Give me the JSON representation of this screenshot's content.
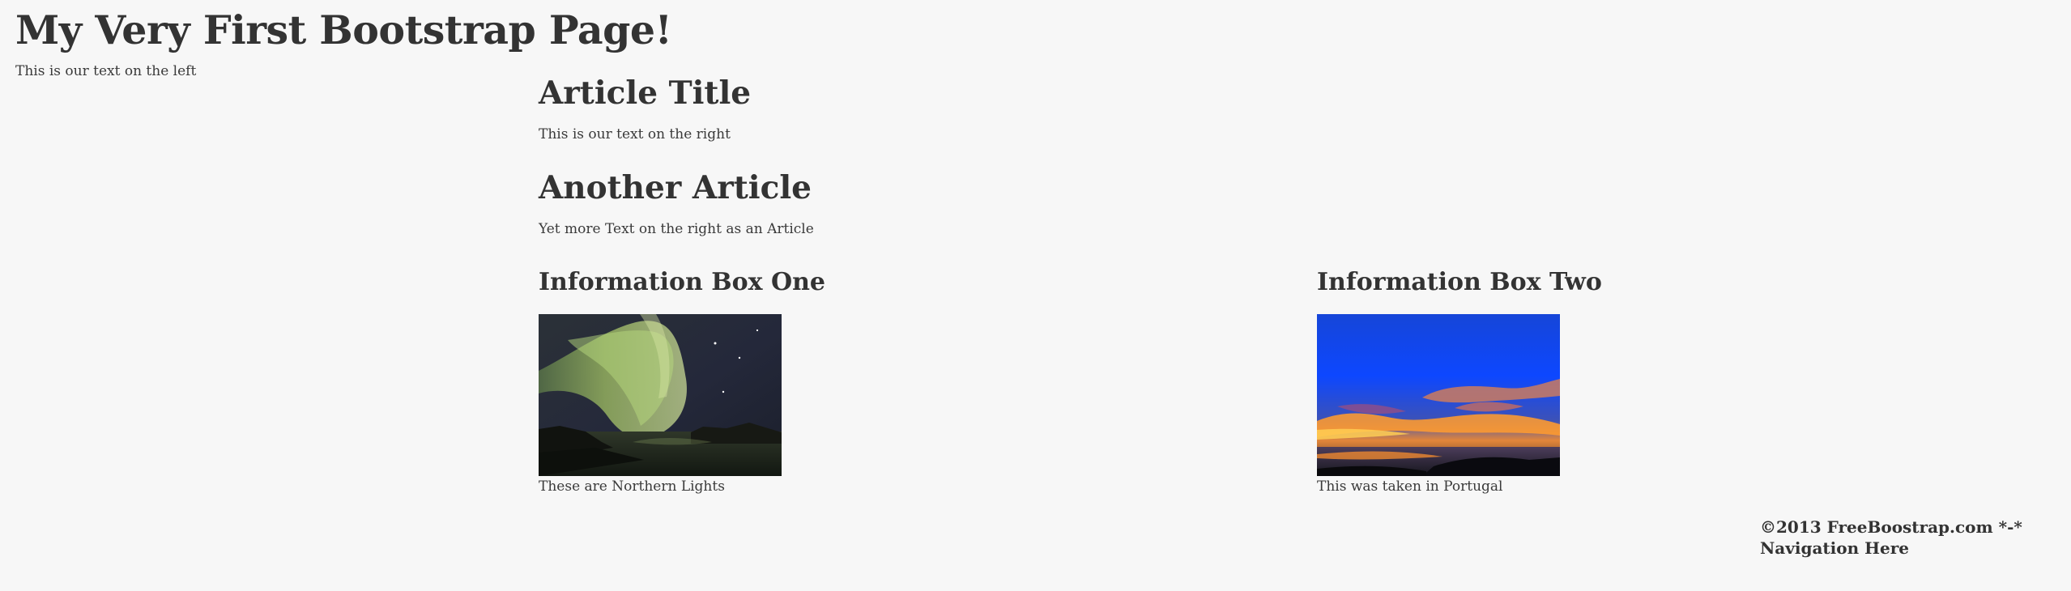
{
  "header": {
    "title": "My Very First Bootstrap Page!",
    "left_text": "This is our text on the left"
  },
  "articles": [
    {
      "title": "Article Title",
      "text": "This is our text on the right"
    },
    {
      "title": "Another Article",
      "text": "Yet more Text on the right as an Article"
    }
  ],
  "info_boxes": [
    {
      "title": "Information Box One",
      "image_icon": "northern-lights-photo",
      "caption": "These are Northern Lights"
    },
    {
      "title": "Information Box Two",
      "image_icon": "sunset-photo",
      "caption": "This was taken in Portugal"
    }
  ],
  "footer": {
    "copyright": "©2013 FreeBoostrap.com *-*",
    "navigation": "Navigation Here"
  },
  "colors": {
    "background": "#f7f7f7",
    "text": "#333333"
  }
}
